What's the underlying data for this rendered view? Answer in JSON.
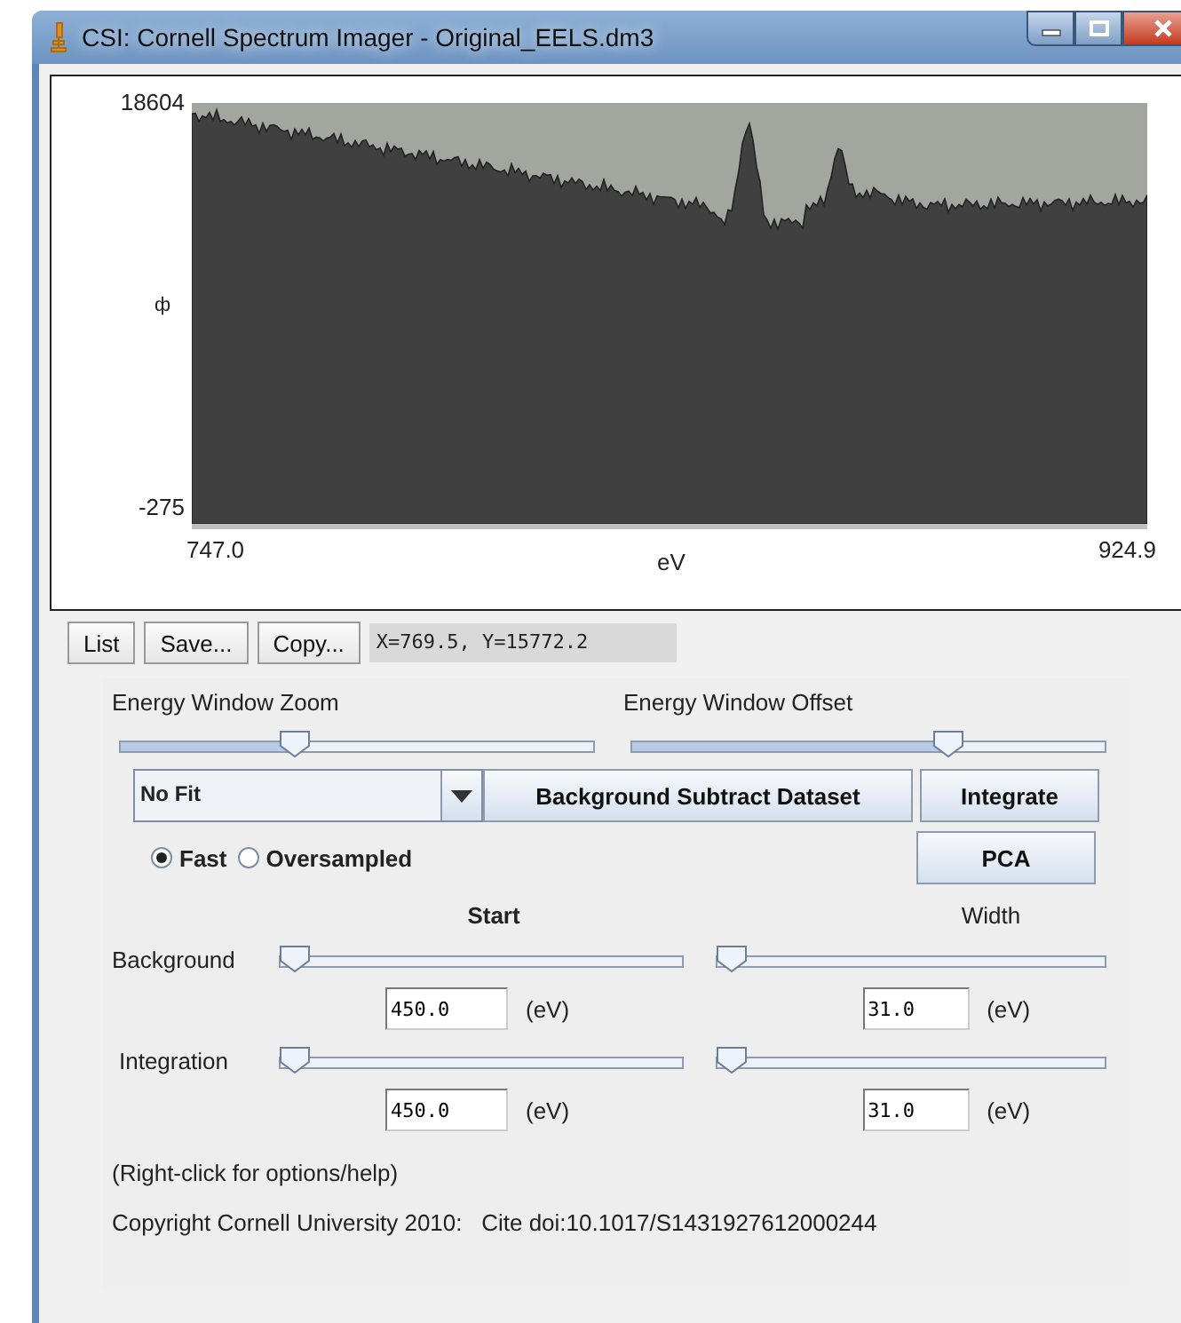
{
  "window": {
    "title": "CSI: Cornell Spectrum Imager - Original_EELS.dm3"
  },
  "plot": {
    "y_max": "18604",
    "y_min": "-275",
    "y_label": "ф",
    "x_min": "747.0",
    "x_max": "924.9",
    "x_label": "eV"
  },
  "toolbar": {
    "buttons": [
      "List",
      "Save...",
      "Copy..."
    ],
    "readout": "X=769.5, Y=15772.2"
  },
  "energy_window": [
    {
      "label": "Energy Window Zoom",
      "level": 0.36
    },
    {
      "label": "Energy Window Offset",
      "level": 0.68
    }
  ],
  "fit": {
    "value": "No Fit"
  },
  "actions": [
    "Background Subtract Dataset",
    "Integrate",
    "PCA"
  ],
  "modes": [
    {
      "label": "Fast",
      "selected": true
    },
    {
      "label": "Oversampled",
      "selected": false
    }
  ],
  "columns": [
    {
      "label": "Start",
      "bold": true
    },
    {
      "label": "Width",
      "bold": false
    }
  ],
  "windows": [
    {
      "label": "Background",
      "start": {
        "level": 0,
        "value": "450.0",
        "unit": "(eV)"
      },
      "width": {
        "level": 0,
        "value": "31.0",
        "unit": "(eV)"
      }
    },
    {
      "label": "Integration",
      "start": {
        "level": 0,
        "value": "450.0",
        "unit": "(eV)"
      },
      "width": {
        "level": 0,
        "value": "31.0",
        "unit": "(eV)"
      }
    }
  ],
  "help": "(Right-click for options/help)",
  "copyright": "Copyright Cornell University 2010:   Cite doi:10.1017/S1431927612000244"
}
